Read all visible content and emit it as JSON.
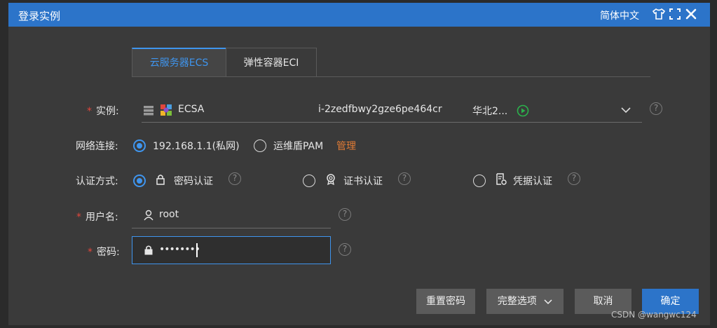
{
  "titlebar": {
    "title": "登录实例",
    "language": "简体中文"
  },
  "tabs": [
    {
      "label": "云服务器ECS",
      "active": true
    },
    {
      "label": "弹性容器ECI",
      "active": false
    }
  ],
  "form": {
    "instance": {
      "label": "实例:",
      "name": "ECSA",
      "id": "i-2zedfbwy2gze6pe464cr",
      "region": "华北2..."
    },
    "network": {
      "label": "网络连接:",
      "options": [
        "192.168.1.1(私网)",
        "运维盾PAM"
      ],
      "selected": 0,
      "manage_link": "管理"
    },
    "auth": {
      "label": "认证方式:",
      "options": [
        "密码认证",
        "证书认证",
        "凭据认证"
      ],
      "selected": 0
    },
    "username": {
      "label": "用户名:",
      "value": "root"
    },
    "password": {
      "label": "密码:",
      "value": "••••••••"
    }
  },
  "buttons": {
    "reset_password": "重置密码",
    "full_options": "完整选项",
    "cancel": "取消",
    "confirm": "确定"
  },
  "help_glyph": "?",
  "watermark": "CSDN @wangwc124",
  "colors": {
    "accent": "#2c74c9",
    "link": "#e07b35",
    "required": "#e0463c",
    "running": "#2bb24c"
  }
}
